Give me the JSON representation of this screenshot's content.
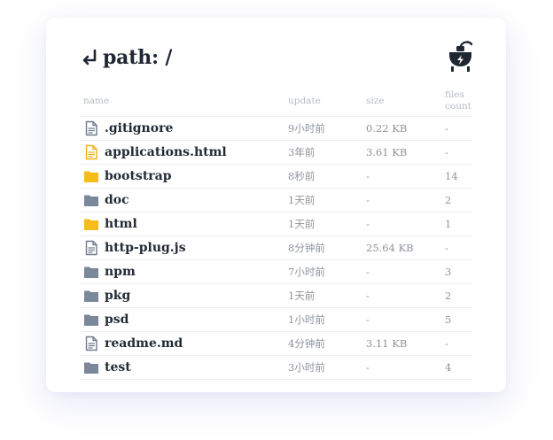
{
  "header": {
    "title": "path: /",
    "back_icon": "return-arrow-icon",
    "plug_icon": "power-plug-icon"
  },
  "columns": {
    "name": "name",
    "update": "update",
    "size": "size",
    "files_count_line1": "files",
    "files_count_line2": "count"
  },
  "colors": {
    "folder_yellow": "#f6bc1a",
    "folder_gray": "#7b879a",
    "file_gray": "#6f7c90",
    "file_yellow": "#efb21a"
  },
  "rows": [
    {
      "name": ".gitignore",
      "icon": "file",
      "color": "gray",
      "update": "9小时前",
      "size": "0.22 KB",
      "count": "-"
    },
    {
      "name": "applications.html",
      "icon": "file",
      "color": "yellow",
      "update": "3年前",
      "size": "3.61 KB",
      "count": "-"
    },
    {
      "name": "bootstrap",
      "icon": "folder",
      "color": "yellow",
      "update": "8秒前",
      "size": "-",
      "count": "14"
    },
    {
      "name": "doc",
      "icon": "folder",
      "color": "gray",
      "update": "1天前",
      "size": "-",
      "count": "2"
    },
    {
      "name": "html",
      "icon": "folder",
      "color": "yellow",
      "update": "1天前",
      "size": "-",
      "count": "1"
    },
    {
      "name": "http-plug.js",
      "icon": "file",
      "color": "gray",
      "update": "8分钟前",
      "size": "25.64 KB",
      "count": "-"
    },
    {
      "name": "npm",
      "icon": "folder",
      "color": "gray",
      "update": "7小时前",
      "size": "-",
      "count": "3"
    },
    {
      "name": "pkg",
      "icon": "folder",
      "color": "gray",
      "update": "1天前",
      "size": "-",
      "count": "2"
    },
    {
      "name": "psd",
      "icon": "folder",
      "color": "gray",
      "update": "1小时前",
      "size": "-",
      "count": "5"
    },
    {
      "name": "readme.md",
      "icon": "file",
      "color": "gray",
      "update": "4分钟前",
      "size": "3.11 KB",
      "count": "-"
    },
    {
      "name": "test",
      "icon": "folder",
      "color": "gray",
      "update": "3小时前",
      "size": "-",
      "count": "4"
    }
  ]
}
